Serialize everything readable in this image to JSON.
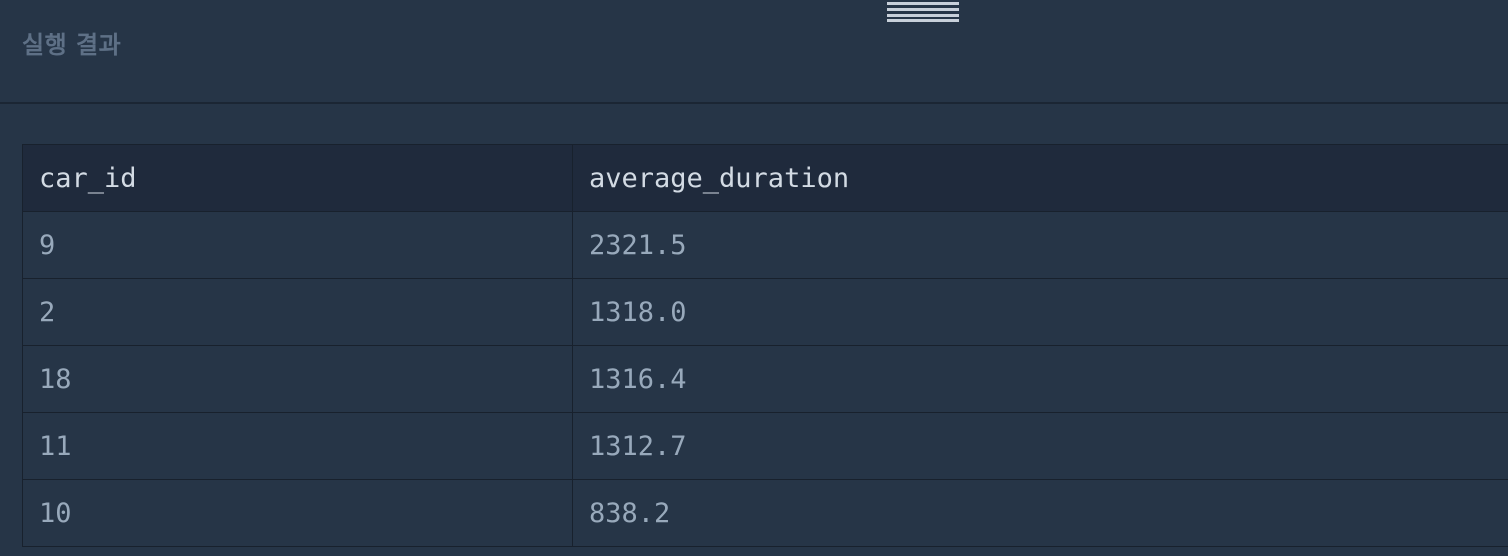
{
  "panel": {
    "title": "실행 결과"
  },
  "table": {
    "columns": [
      "car_id",
      "average_duration"
    ],
    "rows": [
      [
        "9",
        "2321.5"
      ],
      [
        "2",
        "1318.0"
      ],
      [
        "18",
        "1316.4"
      ],
      [
        "11",
        "1312.7"
      ],
      [
        "10",
        "838.2"
      ]
    ]
  },
  "colors": {
    "background": "#263547",
    "header_background": "#1f2a3c",
    "border": "#18212d",
    "title_text": "#5e7086",
    "header_text": "#d3dbe4",
    "cell_text": "#98a9bb"
  }
}
